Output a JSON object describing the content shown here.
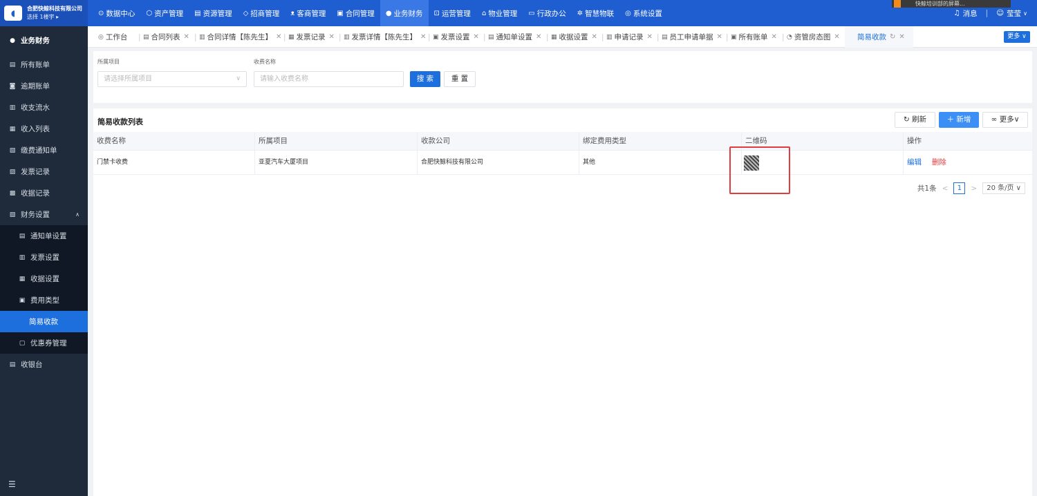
{
  "brand": {
    "company": "合肥快鲸科技有限公司",
    "location": "选择 1楼宇 ▸"
  },
  "topnav": [
    {
      "label": "数据中心",
      "icon": "⊙"
    },
    {
      "label": "资产管理",
      "icon": "⬡"
    },
    {
      "label": "资源管理",
      "icon": "▤"
    },
    {
      "label": "招商管理",
      "icon": "◇"
    },
    {
      "label": "客商管理",
      "icon": "ᴥ"
    },
    {
      "label": "合同管理",
      "icon": "▣"
    },
    {
      "label": "业务财务",
      "icon": "●"
    },
    {
      "label": "运营管理",
      "icon": "⊡"
    },
    {
      "label": "物业管理",
      "icon": "⌂"
    },
    {
      "label": "行政办公",
      "icon": "▭"
    },
    {
      "label": "智慧物联",
      "icon": "✲"
    },
    {
      "label": "系统设置",
      "icon": "◎"
    }
  ],
  "topright": {
    "messages": "消息",
    "user": "莹莹"
  },
  "recbar": "快鲸培训部的屏幕...",
  "sidebar": {
    "header": "业务财务",
    "items": [
      {
        "label": "所有账单",
        "icon": "▤"
      },
      {
        "label": "逾期账单",
        "icon": "◙"
      },
      {
        "label": "收支流水",
        "icon": "▥"
      },
      {
        "label": "收入列表",
        "icon": "▦"
      },
      {
        "label": "缴费通知单",
        "icon": "▧"
      },
      {
        "label": "发票记录",
        "icon": "▨"
      },
      {
        "label": "收据记录",
        "icon": "▩"
      },
      {
        "label": "财务设置",
        "icon": "▧"
      },
      {
        "label": "通知单设置",
        "icon": "▤"
      },
      {
        "label": "发票设置",
        "icon": "▥"
      },
      {
        "label": "收据设置",
        "icon": "▦"
      },
      {
        "label": "费用类型",
        "icon": "▣"
      },
      {
        "label": "简易收款",
        "icon": ""
      },
      {
        "label": "优惠券管理",
        "icon": "▢"
      },
      {
        "label": "收银台",
        "icon": "▤"
      }
    ]
  },
  "tabs": [
    {
      "label": "工作台",
      "icon": "◎"
    },
    {
      "label": "合同列表",
      "icon": "▤"
    },
    {
      "label": "合同详情【陈先生】",
      "icon": "▥"
    },
    {
      "label": "发票记录",
      "icon": "▦"
    },
    {
      "label": "发票详情【陈先生】",
      "icon": "▥"
    },
    {
      "label": "发票设置",
      "icon": "▣"
    },
    {
      "label": "通知单设置",
      "icon": "▤"
    },
    {
      "label": "收据设置",
      "icon": "▦"
    },
    {
      "label": "申请记录",
      "icon": "▥"
    },
    {
      "label": "员工申请单据",
      "icon": "▤"
    },
    {
      "label": "所有账单",
      "icon": "▣"
    },
    {
      "label": "资管房态图",
      "icon": "◔"
    },
    {
      "label": "简易收款",
      "icon": ""
    }
  ],
  "tabs_more": "更多 ∨",
  "filter": {
    "project_label": "所属项目",
    "project_placeholder": "请选择所属项目",
    "name_label": "收费名称",
    "name_placeholder": "请输入收费名称",
    "search": "搜 索",
    "reset": "重 置"
  },
  "table": {
    "title": "简易收款列表",
    "refresh": "刷新",
    "add": "新增",
    "more": "更多",
    "headers": [
      "收费名称",
      "所属项目",
      "收款公司",
      "绑定费用类型",
      "二维码",
      "操作"
    ],
    "rows": [
      {
        "name": "门禁卡收费",
        "project": "亚夏汽车大厦项目",
        "company": "合肥快鲸科技有限公司",
        "fee_type": "其他",
        "edit": "编辑",
        "delete": "删除"
      }
    ]
  },
  "pager": {
    "total": "共1条",
    "page": "1",
    "size": "20 条/页"
  },
  "colors": {
    "primary": "#1e6fde",
    "topbar": "#1e5ed1",
    "sidebar": "#1f2b3b",
    "danger": "#e23b3b"
  }
}
